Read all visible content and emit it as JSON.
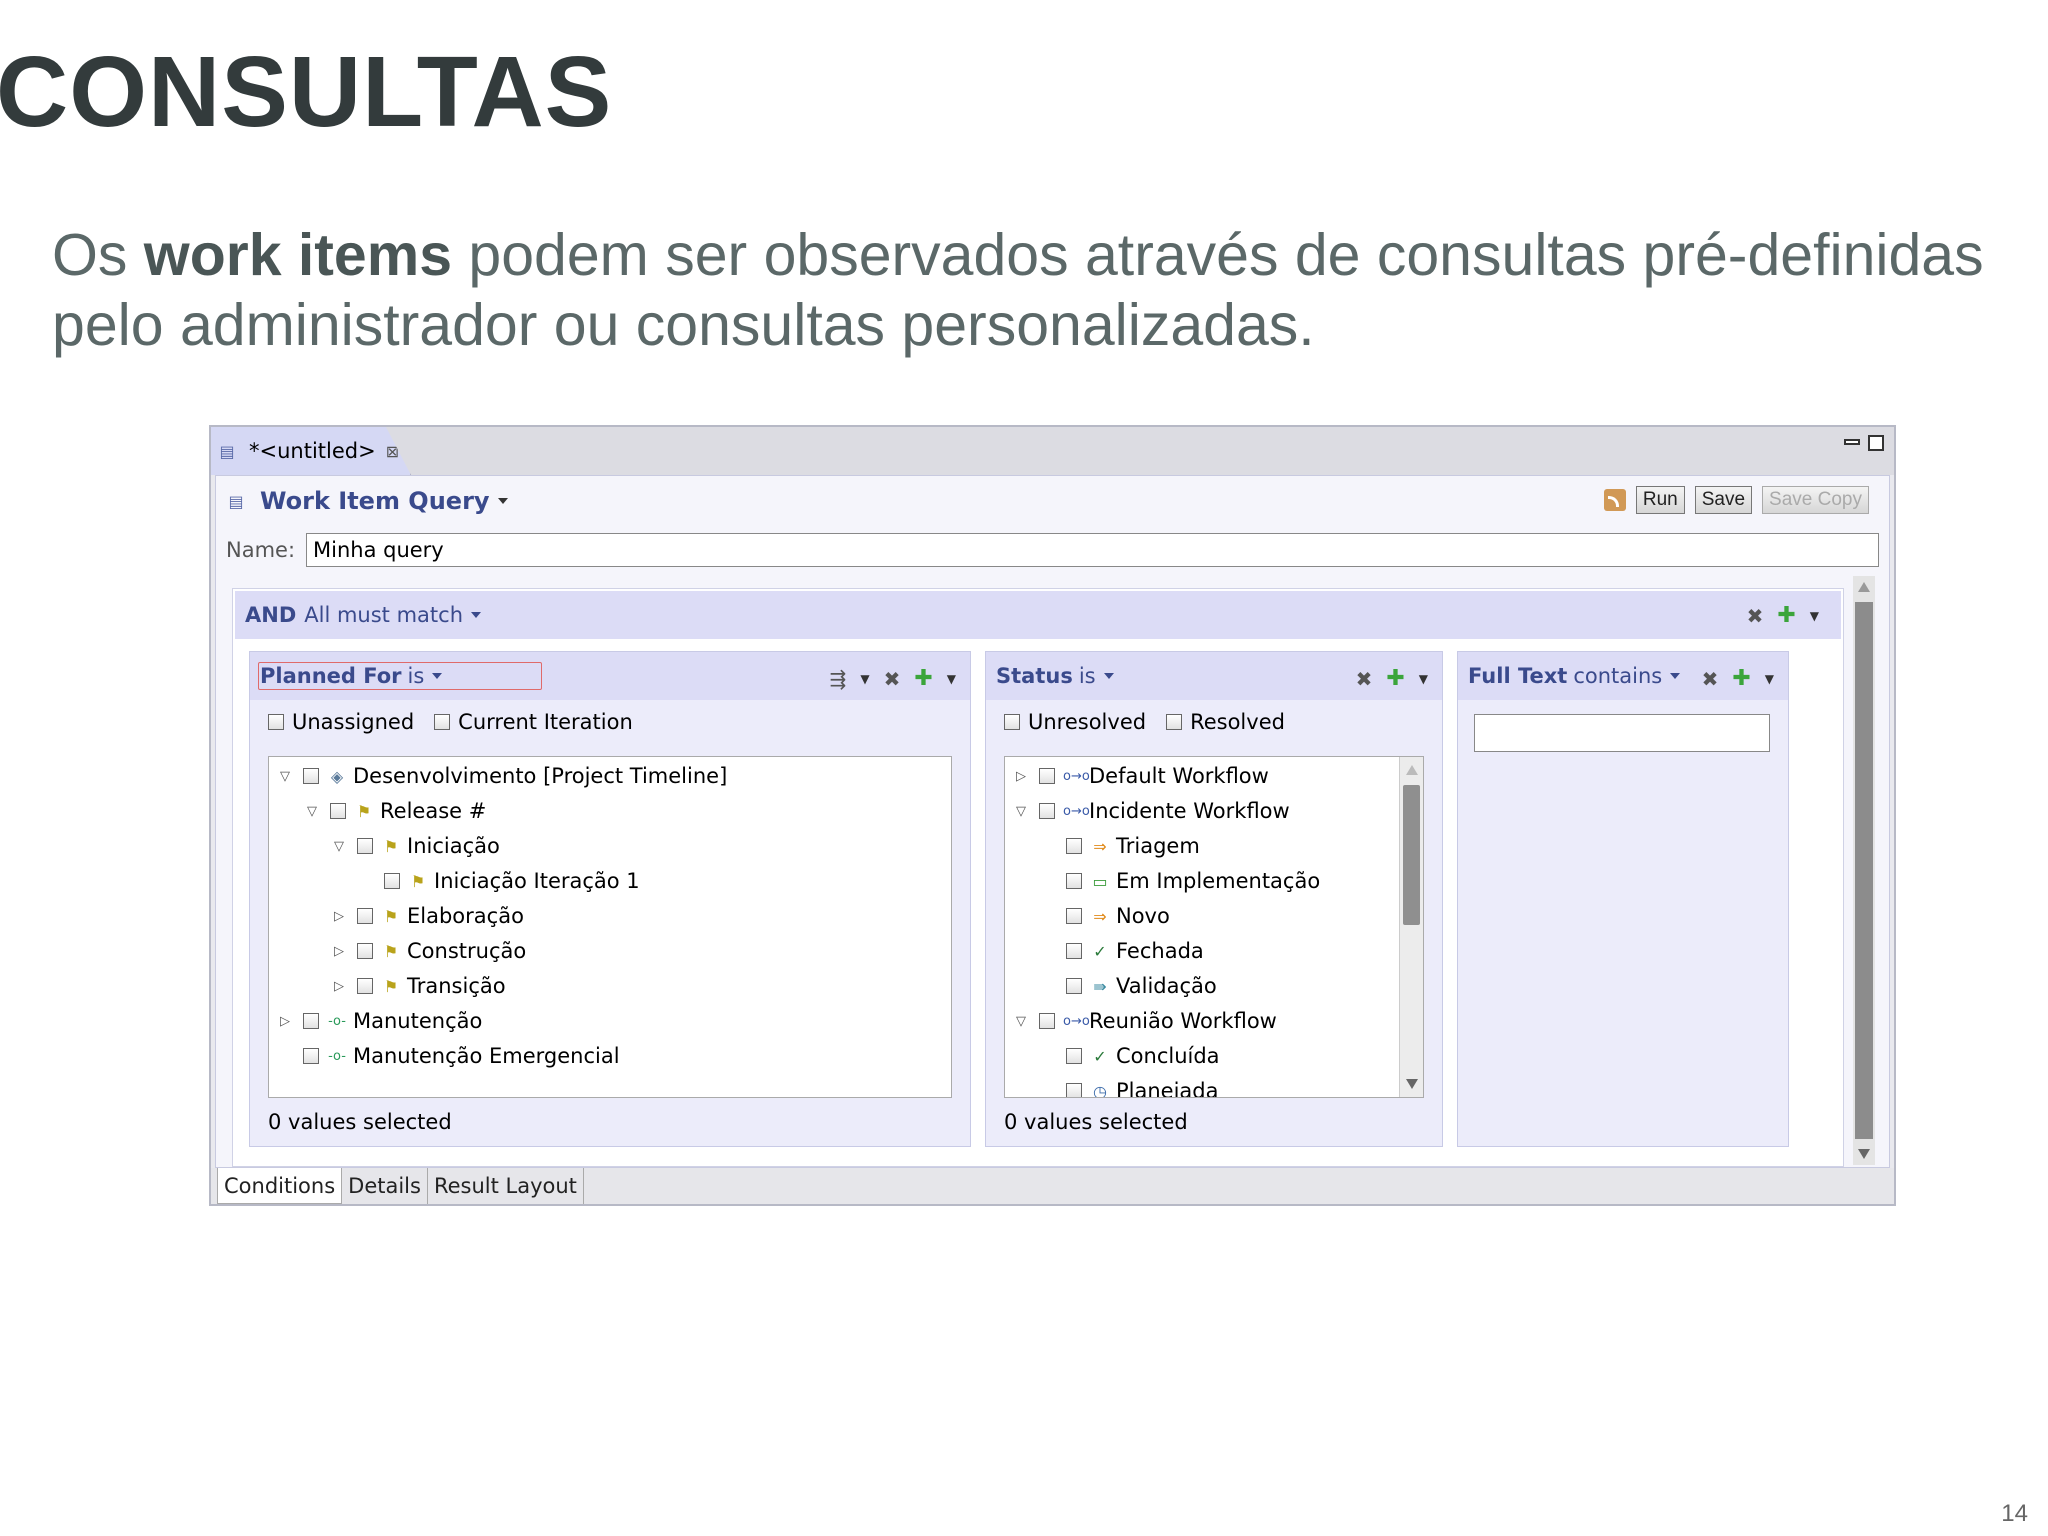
{
  "slide": {
    "title": "CONSULTAS",
    "text_before": "Os ",
    "text_bold": "work items",
    "text_after": " podem ser observados através de consultas pré-definidas pelo administrador ou consultas personalizadas.",
    "page_number": "14"
  },
  "editor": {
    "tab_label": "*<untitled>",
    "query_title": "Work Item Query",
    "buttons": {
      "run": "Run",
      "save": "Save",
      "save_copy": "Save Copy"
    },
    "name_label": "Name:",
    "name_value": "Minha query",
    "and_key": "AND",
    "and_text": "All must match",
    "bottom_tabs": [
      "Conditions",
      "Details",
      "Result Layout"
    ]
  },
  "planned_for": {
    "key": "Planned For",
    "op": "is",
    "checks": [
      "Unassigned",
      "Current Iteration"
    ],
    "tree": [
      {
        "label": "Desenvolvimento [Project Timeline]",
        "level": 0,
        "twisty": "open",
        "icon": "timeline-icon"
      },
      {
        "label": "Release #",
        "level": 1,
        "twisty": "open",
        "icon": "iteration-icon"
      },
      {
        "label": "Iniciação",
        "level": 2,
        "twisty": "open",
        "icon": "iteration-icon"
      },
      {
        "label": "Iniciação Iteração 1",
        "level": 3,
        "twisty": "none",
        "icon": "iteration-icon"
      },
      {
        "label": "Elaboração",
        "level": 2,
        "twisty": "closed",
        "icon": "iteration-icon"
      },
      {
        "label": "Construção",
        "level": 2,
        "twisty": "closed",
        "icon": "iteration-icon"
      },
      {
        "label": "Transição",
        "level": 2,
        "twisty": "closed",
        "icon": "iteration-icon"
      },
      {
        "label": "Manutenção",
        "level": 0,
        "twisty": "closed",
        "icon": "timeline-line-icon"
      },
      {
        "label": "Manutenção Emergencial",
        "level": 0,
        "twisty": "none",
        "icon": "timeline-line-icon"
      }
    ],
    "values_selected": "0 values selected"
  },
  "status": {
    "key": "Status",
    "op": "is",
    "checks": [
      "Unresolved",
      "Resolved"
    ],
    "tree": [
      {
        "label": "Default Workflow",
        "level": 0,
        "twisty": "closed",
        "icon": "workflow-icon"
      },
      {
        "label": "Incidente Workflow",
        "level": 0,
        "twisty": "open",
        "icon": "workflow-icon"
      },
      {
        "label": "Triagem",
        "level": 1,
        "twisty": "none",
        "icon": "arrow-icon"
      },
      {
        "label": "Em Implementação",
        "level": 1,
        "twisty": "none",
        "icon": "in-progress-icon"
      },
      {
        "label": "Novo",
        "level": 1,
        "twisty": "none",
        "icon": "arrow-icon"
      },
      {
        "label": "Fechada",
        "level": 1,
        "twisty": "none",
        "icon": "check-icon"
      },
      {
        "label": "Validação",
        "level": 1,
        "twisty": "none",
        "icon": "validate-icon"
      },
      {
        "label": "Reunião Workflow",
        "level": 0,
        "twisty": "open",
        "icon": "workflow-icon"
      },
      {
        "label": "Concluída",
        "level": 1,
        "twisty": "none",
        "icon": "check-icon"
      },
      {
        "label": "Planejada",
        "level": 1,
        "twisty": "none",
        "icon": "clock-icon"
      }
    ],
    "values_selected": "0 values selected"
  },
  "full_text": {
    "key": "Full Text",
    "op": "contains",
    "value": ""
  }
}
